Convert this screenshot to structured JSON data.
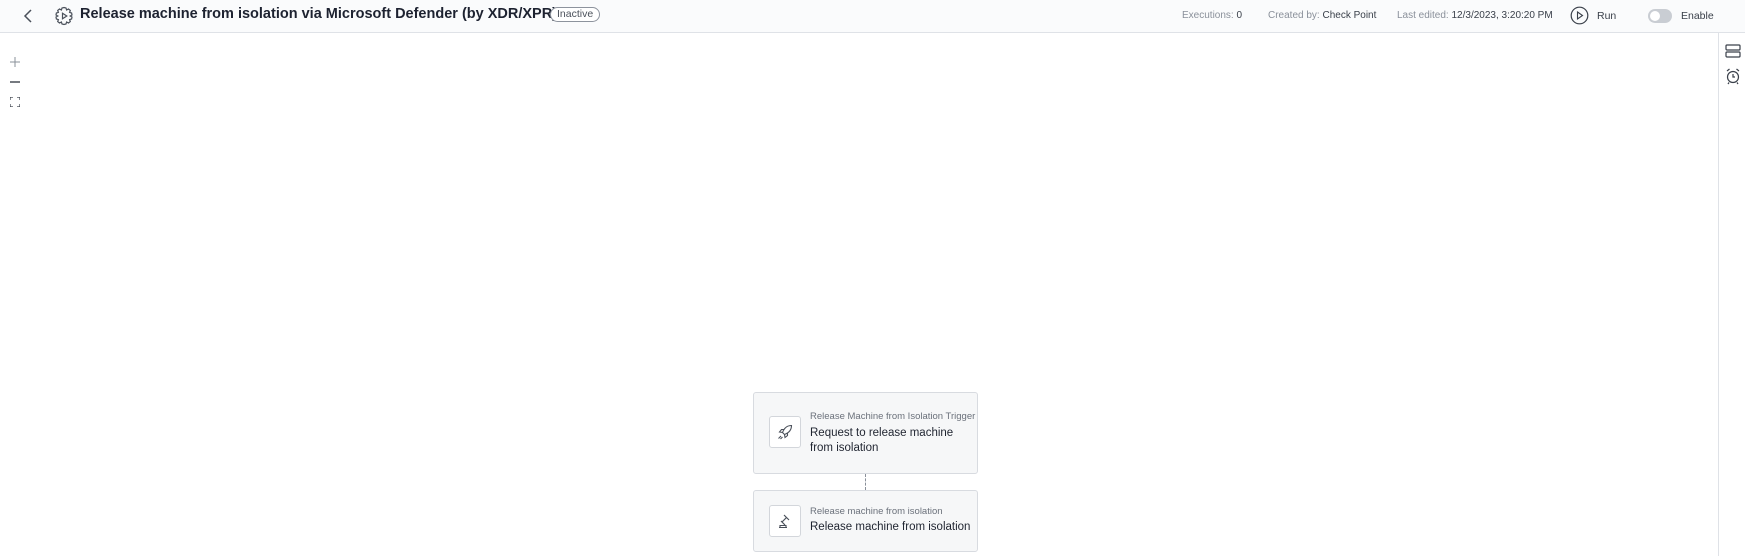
{
  "header": {
    "title": "Release machine from isolation via Microsoft Defender (by XDR/XPR)",
    "status": "Inactive",
    "executions_label": "Executions:",
    "executions_value": "0",
    "created_label": "Created by:",
    "created_value": "Check Point",
    "edited_label": "Last edited:",
    "edited_value": "12/3/2023, 3:20:20 PM",
    "run_label": "Run",
    "enable_label": "Enable",
    "enabled": false
  },
  "canvas": {
    "nodes": [
      {
        "subtitle": "Release Machine from Isolation Trigger",
        "title": "Request to release machine from isolation",
        "icon": "rocket-icon"
      },
      {
        "subtitle": "Release machine from isolation",
        "title": "Release machine from isolation",
        "icon": "gavel-icon"
      }
    ]
  },
  "colors": {
    "header_bg": "#fafbfc",
    "node_bg": "#f6f7f8",
    "border": "#d8dbe0",
    "toggle_off": "#c9cdd3"
  }
}
